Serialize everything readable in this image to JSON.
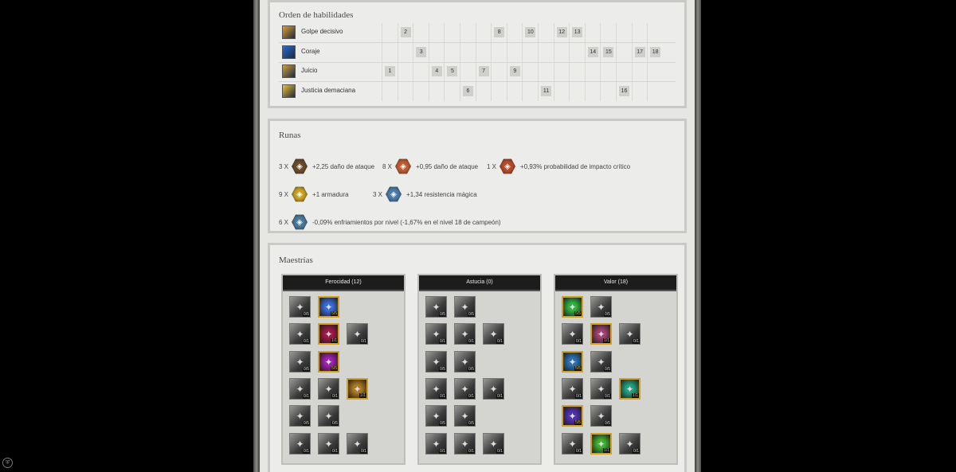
{
  "skill_order": {
    "title": "Orden de habilidades",
    "skills": [
      {
        "name": "Golpe decisivo",
        "icon": "golpe-decisivo-icon",
        "color": "#e0a030",
        "levels": [
          "",
          "2",
          "",
          "",
          "",
          "",
          "",
          "8",
          "",
          "10",
          "",
          "12",
          "13",
          "",
          "",
          "",
          "",
          ""
        ]
      },
      {
        "name": "Coraje",
        "icon": "coraje-icon",
        "color": "#2a6ad0",
        "levels": [
          "",
          "",
          "3",
          "",
          "",
          "",
          "",
          "",
          "",
          "",
          "",
          "",
          "",
          "14",
          "15",
          "",
          "17",
          "18"
        ]
      },
      {
        "name": "Juicio",
        "icon": "juicio-icon",
        "color": "#d0a040",
        "levels": [
          "1",
          "",
          "",
          "4",
          "5",
          "",
          "7",
          "",
          "9",
          "",
          "",
          "",
          "",
          "",
          "",
          "",
          "",
          ""
        ]
      },
      {
        "name": "Justicia demaciana",
        "icon": "justicia-demaciana-icon",
        "color": "#f0c030",
        "levels": [
          "",
          "",
          "",
          "",
          "",
          "6",
          "",
          "",
          "",
          "",
          "11",
          "",
          "",
          "",
          "",
          "16",
          "",
          ""
        ]
      }
    ]
  },
  "runes": {
    "title": "Runas",
    "items": [
      {
        "count": "3 X",
        "text": "+2,25 daño de ataque",
        "color": "#6a4a2a",
        "icon": "mark-attack-damage-icon"
      },
      {
        "count": "8 X",
        "text": "+0,95 daño de ataque",
        "color": "#c05a30",
        "icon": "quint-attack-damage-icon"
      },
      {
        "count": "1 X",
        "text": "+0,93% probabilidad de impacto crítico",
        "color": "#b84a28",
        "icon": "quint-crit-chance-icon"
      },
      {
        "count": "9 X",
        "text": "+1 armadura",
        "color": "#c8a020",
        "icon": "seal-armor-icon"
      },
      {
        "count": "3 X",
        "text": "+1,34 resistencia mágica",
        "color": "#4a7aa8",
        "icon": "glyph-magic-resist-icon"
      },
      {
        "count": "6 X",
        "text": "-0,09% enfriamientos por nivel (-1,67% en el nivel 18 de campeón)",
        "color": "#4a7a9a",
        "icon": "glyph-cooldown-icon"
      }
    ]
  },
  "masteries": {
    "title": "Maestrías",
    "trees": [
      {
        "name": "Ferocidad (12)",
        "rows": [
          [
            {
              "rank": "0/5"
            },
            {
              "rank": "5/5",
              "active": true,
              "color": "#3a6ad8"
            }
          ],
          [
            {
              "rank": "0/1"
            },
            {
              "rank": "1/1",
              "active": true,
              "color": "#a01848"
            },
            {
              "rank": "0/1"
            }
          ],
          [
            {
              "rank": "0/5"
            },
            {
              "rank": "5/5",
              "active": true,
              "color": "#a020b0"
            }
          ],
          [
            {
              "rank": "0/1"
            },
            {
              "rank": "0/1"
            },
            {
              "rank": "1/1",
              "active": true,
              "color": "#b07a20"
            }
          ],
          [
            {
              "rank": "0/5"
            },
            {
              "rank": "0/5"
            }
          ],
          [
            {
              "rank": "0/1"
            },
            {
              "rank": "0/1"
            },
            {
              "rank": "0/1"
            }
          ]
        ]
      },
      {
        "name": "Astucia (0)",
        "rows": [
          [
            {
              "rank": "0/5"
            },
            {
              "rank": "0/5"
            }
          ],
          [
            {
              "rank": "0/1"
            },
            {
              "rank": "0/1"
            },
            {
              "rank": "0/1"
            }
          ],
          [
            {
              "rank": "0/5"
            },
            {
              "rank": "0/5"
            }
          ],
          [
            {
              "rank": "0/1"
            },
            {
              "rank": "0/1"
            },
            {
              "rank": "0/1"
            }
          ],
          [
            {
              "rank": "0/5"
            },
            {
              "rank": "0/5"
            }
          ],
          [
            {
              "rank": "0/1"
            },
            {
              "rank": "0/1"
            },
            {
              "rank": "0/1"
            }
          ]
        ]
      },
      {
        "name": "Valor (18)",
        "rows": [
          [
            {
              "rank": "5/5",
              "active": true,
              "color": "#30b040"
            },
            {
              "rank": "0/5"
            }
          ],
          [
            {
              "rank": "0/1"
            },
            {
              "rank": "1/1",
              "active": true,
              "color": "#a04070"
            },
            {
              "rank": "0/1"
            }
          ],
          [
            {
              "rank": "5/5",
              "active": true,
              "color": "#2a70b0"
            },
            {
              "rank": "0/5"
            }
          ],
          [
            {
              "rank": "0/1"
            },
            {
              "rank": "0/1"
            },
            {
              "rank": "1/1",
              "active": true,
              "color": "#20a080"
            }
          ],
          [
            {
              "rank": "5/5",
              "active": true,
              "color": "#5030b0"
            },
            {
              "rank": "0/5"
            }
          ],
          [
            {
              "rank": "0/1"
            },
            {
              "rank": "1/1",
              "active": true,
              "color": "#40b030"
            },
            {
              "rank": "0/1"
            }
          ]
        ]
      }
    ]
  }
}
